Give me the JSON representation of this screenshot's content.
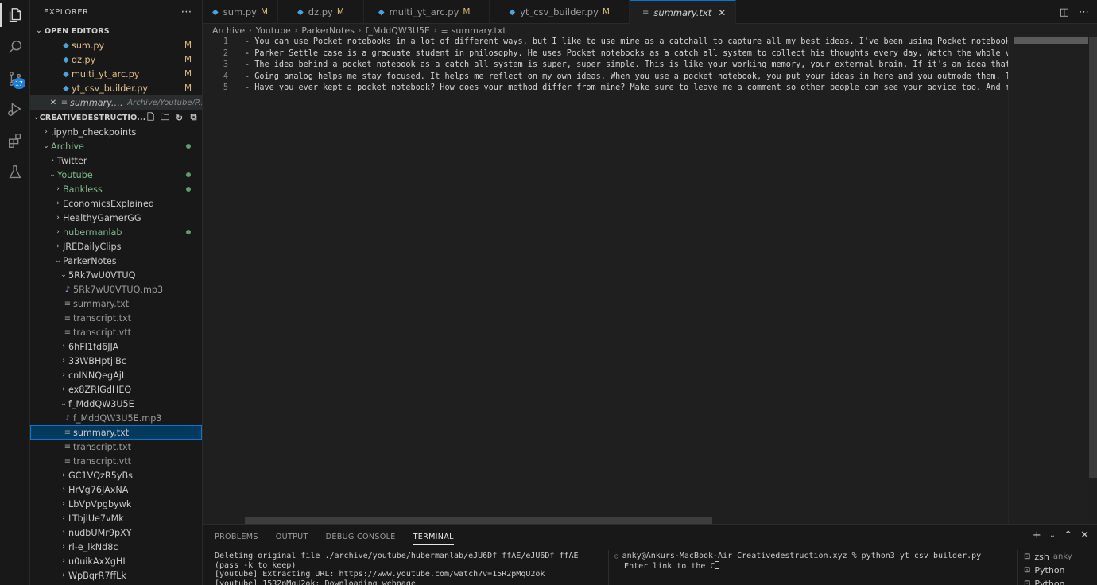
{
  "activity": {
    "source_control_badge": "17"
  },
  "sidebar": {
    "title": "EXPLORER",
    "more_icon": "ellipsis-icon",
    "open_editors_title": "OPEN EDITORS",
    "open_editors": [
      {
        "name": "sum.py",
        "mark": "M"
      },
      {
        "name": "dz.py",
        "mark": "M"
      },
      {
        "name": "multi_yt_arc.py",
        "mark": "M"
      },
      {
        "name": "yt_csv_builder.py",
        "mark": "M"
      }
    ],
    "active_editor": {
      "name": "summary.txt",
      "path": "Archive/Youtube/P..."
    },
    "workspace_title": "CREATIVEDESTRUCTIO...",
    "tree": [
      {
        "label": ".ipynb_checkpoints"
      },
      {
        "label": "Archive"
      },
      {
        "label": "Twitter"
      },
      {
        "label": "Youtube"
      },
      {
        "label": "Bankless"
      },
      {
        "label": "EconomicsExplained"
      },
      {
        "label": "HealthyGamerGG"
      },
      {
        "label": "hubermanlab"
      },
      {
        "label": "JREDailyClips"
      },
      {
        "label": "ParkerNotes"
      },
      {
        "label": "5Rk7wU0VTUQ"
      },
      {
        "label": "5Rk7wU0VTUQ.mp3"
      },
      {
        "label": "summary.txt"
      },
      {
        "label": "transcript.txt"
      },
      {
        "label": "transcript.vtt"
      },
      {
        "label": "6hFI1fd6JJA"
      },
      {
        "label": "33WBHptjlBc"
      },
      {
        "label": "cnINNQegAjI"
      },
      {
        "label": "ex8ZRIGdHEQ"
      },
      {
        "label": "f_MddQW3U5E"
      },
      {
        "label": "f_MddQW3U5E.mp3"
      },
      {
        "label": "summary.txt"
      },
      {
        "label": "transcript.txt"
      },
      {
        "label": "transcript.vtt"
      },
      {
        "label": "GC1VQzR5yBs"
      },
      {
        "label": "HrVg76JAxNA"
      },
      {
        "label": "LbVpVpgbywk"
      },
      {
        "label": "LTbjlUe7vMk"
      },
      {
        "label": "nudbUMr9pXY"
      },
      {
        "label": "rl-e_lkNd8c"
      },
      {
        "label": "u0uikAxXgHI"
      },
      {
        "label": "WpBqrR7ffLk"
      }
    ]
  },
  "tabs": [
    {
      "label": "sum.py",
      "mark": "M"
    },
    {
      "label": "dz.py",
      "mark": "M"
    },
    {
      "label": "multi_yt_arc.py",
      "mark": "M"
    },
    {
      "label": "yt_csv_builder.py",
      "mark": "M"
    },
    {
      "label": "summary.txt",
      "close": "✕"
    }
  ],
  "breadcrumb": [
    "Archive",
    "Youtube",
    "ParkerNotes",
    "f_MddQW3U5E",
    "summary.txt"
  ],
  "editor": {
    "lines": [
      {
        "n": "1",
        "text": "- You can use Pocket notebooks in a lot of different ways, but I like to use mine as a catchall to capture all my best ideas. I've been using Pocket notebooks as"
      },
      {
        "n": "2",
        "text": "- Parker Settle case is a graduate student in philosophy. He uses Pocket notebooks as a catch all system to collect his thoughts every day. Watch the whole video"
      },
      {
        "n": "3",
        "text": "- The idea behind a pocket notebook as a catch all system is super, super simple. This is like your working memory, your external brain. If it's an idea that I do"
      },
      {
        "n": "4",
        "text": "- Going analog helps me stay focused. It helps me reflect on my own ideas. When you use a pocket notebook, you put your ideas in here and you outmode them. The be"
      },
      {
        "n": "5",
        "text": "- Have you ever kept a pocket notebook? How does your method differ from mine? Make sure to leave me a comment so other people can see your advice too. And make s"
      }
    ]
  },
  "panel": {
    "tabs": [
      "PROBLEMS",
      "OUTPUT",
      "DEBUG CONSOLE",
      "TERMINAL"
    ],
    "terminal_left": "Deleting original file ./archive/youtube/hubermanlab/eJU6Df_ffAE/eJU6Df_ffAE (pass -k to keep)\n[youtube] Extracting URL: https://www.youtube.com/watch?v=15R2pMqU2ok\n[youtube] 15R2pMqU2ok: Downloading webpage",
    "terminal_right_prompt": "anky@Ankurs-MacBook-Air Creativedestruction.xyz % python3 yt_csv_builder.py",
    "terminal_right_input": "Enter link to the C",
    "terminal_list": [
      {
        "label": "zsh",
        "sub": "anky"
      },
      {
        "label": "Python",
        "sub": ""
      },
      {
        "label": "Python",
        "sub": ""
      }
    ]
  }
}
